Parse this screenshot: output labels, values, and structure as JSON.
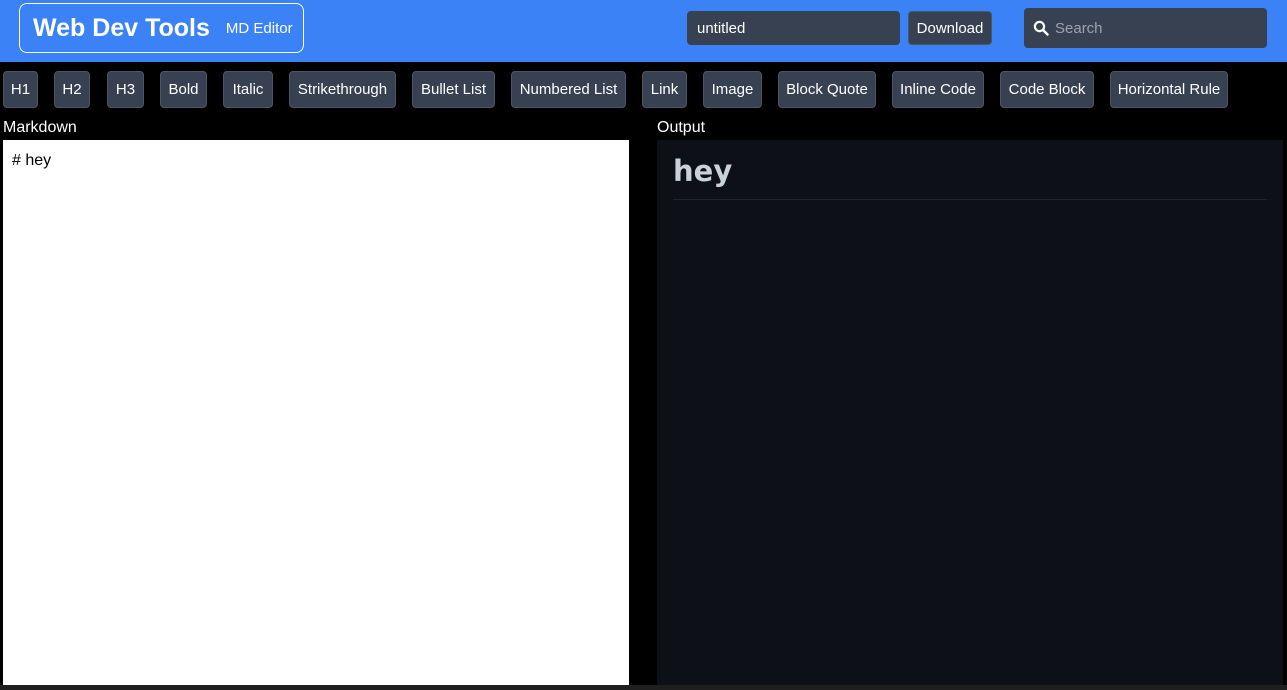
{
  "header": {
    "brand_title": "Web Dev Tools",
    "brand_subtitle": "MD Editor",
    "filename_value": "untitled",
    "download_label": "Download",
    "search_placeholder": "Search",
    "search_icon": "search-icon"
  },
  "toolbar": {
    "items": [
      {
        "label": "H1"
      },
      {
        "label": "H2"
      },
      {
        "label": "H3"
      },
      {
        "label": "Bold"
      },
      {
        "label": "Italic"
      },
      {
        "label": "Strikethrough"
      },
      {
        "label": "Bullet List"
      },
      {
        "label": "Numbered List"
      },
      {
        "label": "Link"
      },
      {
        "label": "Image"
      },
      {
        "label": "Block Quote"
      },
      {
        "label": "Inline Code"
      },
      {
        "label": "Code Block"
      },
      {
        "label": "Horizontal Rule"
      }
    ]
  },
  "markdown_pane": {
    "label": "Markdown",
    "content": "# hey"
  },
  "output_pane": {
    "label": "Output",
    "heading": "hey"
  },
  "colors": {
    "header_bg": "#3b82f6",
    "button_bg": "#374151",
    "output_bg": "#0d1117",
    "output_text": "#c9d1d9"
  }
}
